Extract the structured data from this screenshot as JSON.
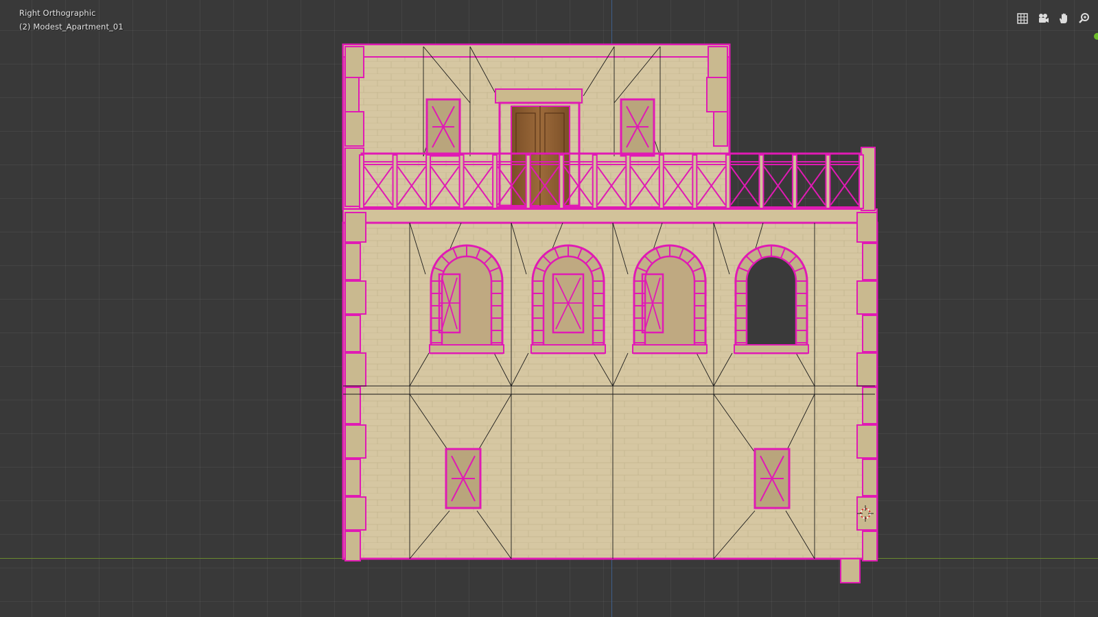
{
  "viewport": {
    "view_name": "Right Orthographic",
    "object_name": "(2) Modest_Apartment_01"
  },
  "navigation_gizmos": [
    {
      "name": "grid-toggle-icon"
    },
    {
      "name": "camera-view-icon"
    },
    {
      "name": "pan-hand-icon"
    },
    {
      "name": "zoom-icon"
    }
  ],
  "colors": {
    "background": "#393939",
    "grid_line": "#4a4a4a",
    "x_axis": "#6b8a2e",
    "z_axis": "#3f5f8c",
    "selection": "#e01ab4",
    "wall": "#d8c9a4",
    "door": "#8a5a2e"
  },
  "scene": {
    "building": "Modest_Apartment_01",
    "upper_floor_windows": 4,
    "ground_floor_windows": 2,
    "balcony_railing_bays": 15
  }
}
